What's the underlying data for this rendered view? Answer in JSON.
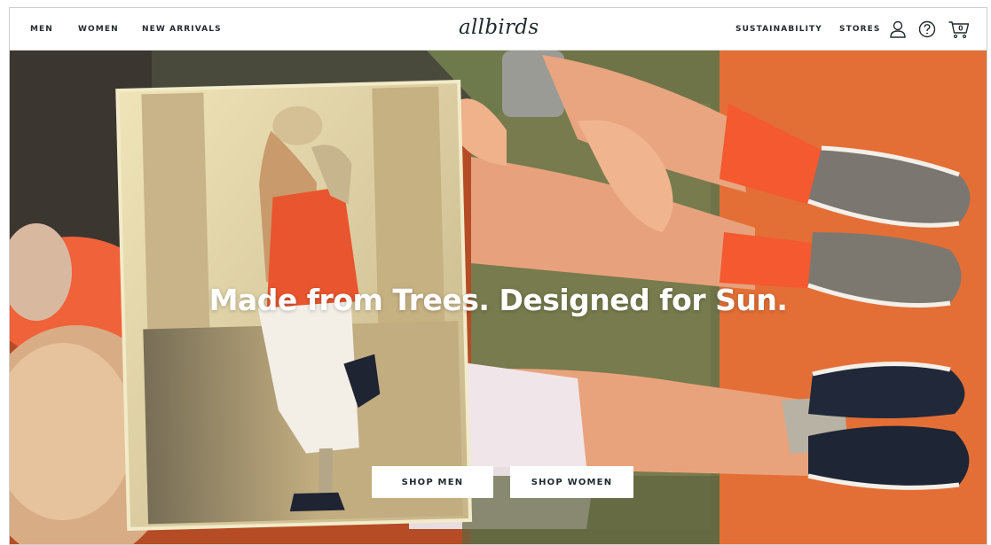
{
  "nav": {
    "left_links": [
      "MEN",
      "WOMEN",
      "NEW ARRIVALS"
    ],
    "logo": "allbirds",
    "right_links": [
      "SUSTAINABILITY",
      "STORES"
    ],
    "icons": [
      "account-icon",
      "help-icon",
      "cart-icon"
    ],
    "cart_count": "0"
  },
  "hero": {
    "headline": "Made from Trees. Designed for Sun.",
    "buttons": {
      "shop_men": "SHOP MEN",
      "shop_women": "SHOP WOMEN"
    }
  },
  "colors": {
    "text": "#212a2f",
    "orange": "#e8743a",
    "sock": "#f4592f",
    "white": "#ffffff"
  }
}
